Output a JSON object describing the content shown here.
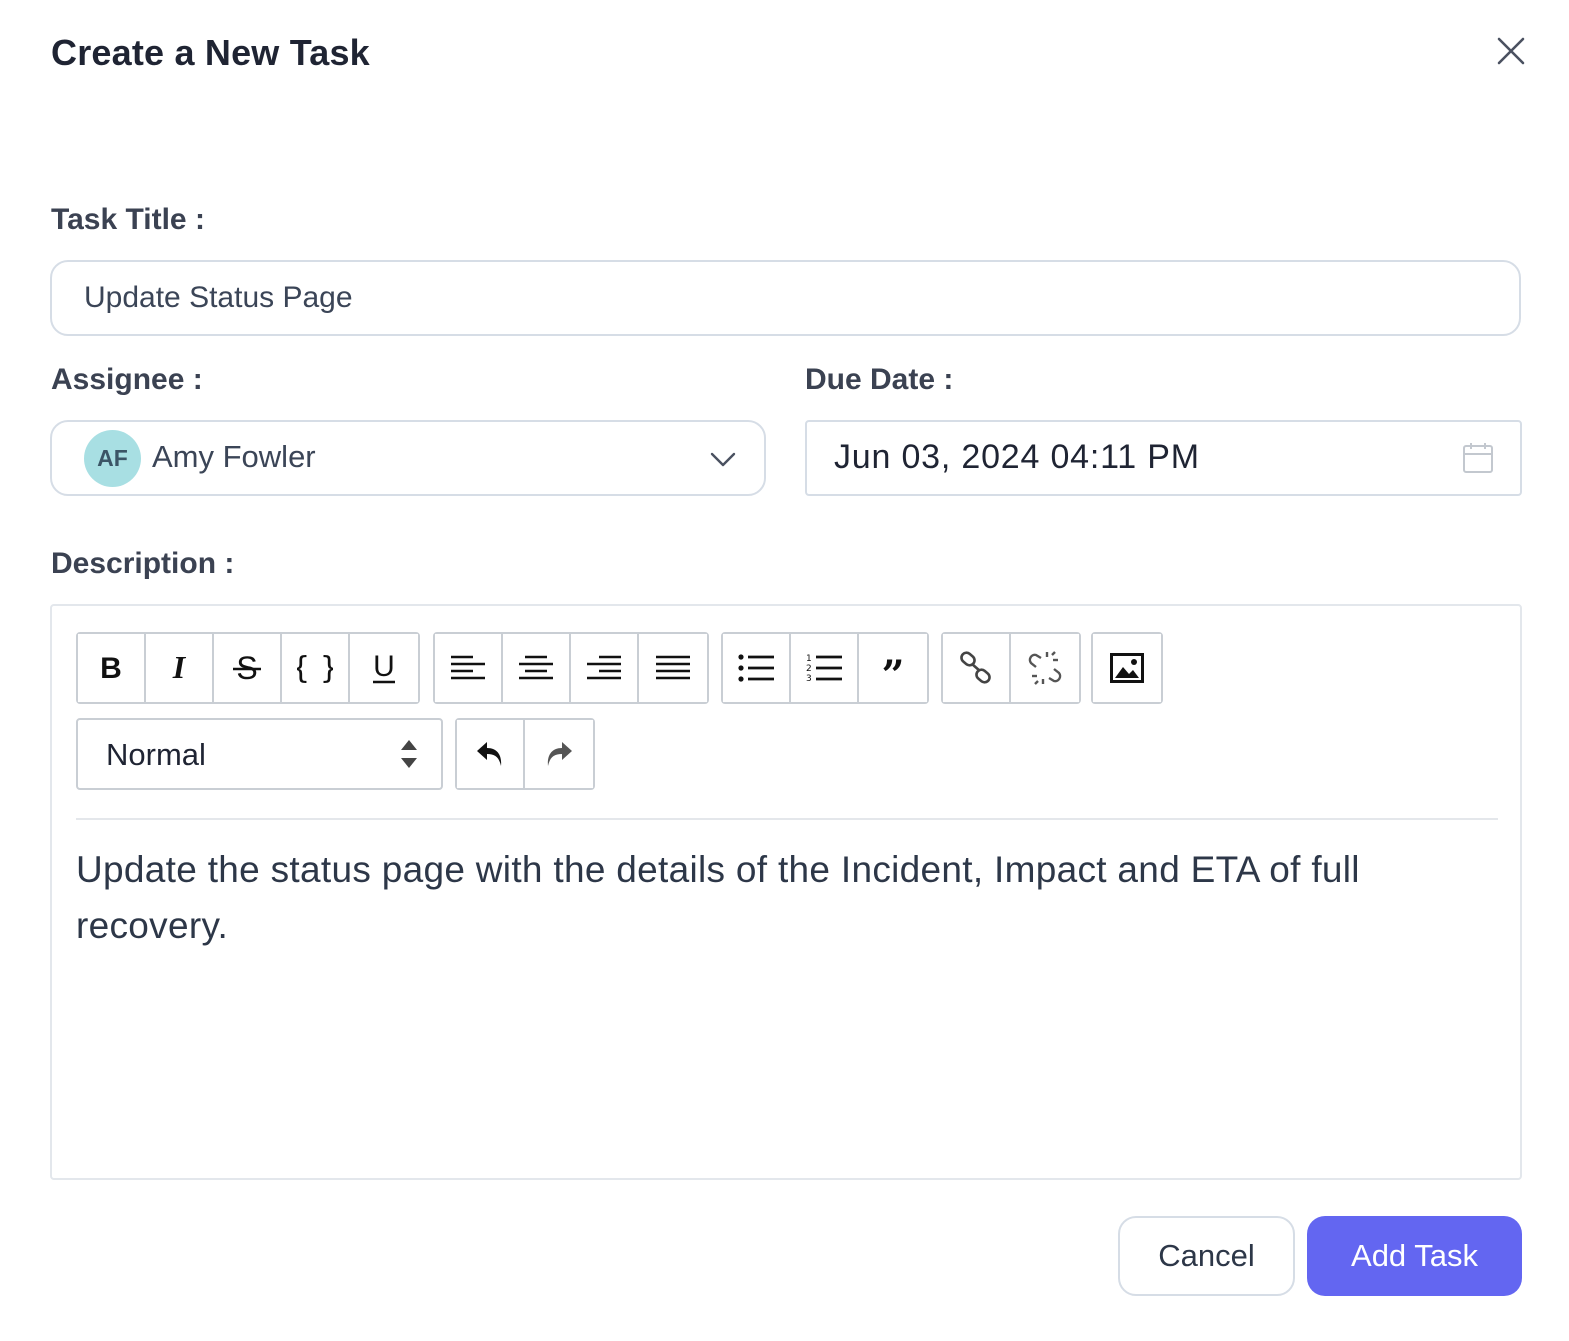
{
  "dialog": {
    "title": "Create a New Task",
    "close_icon": "close-icon"
  },
  "form": {
    "task_title_label": "Task Title :",
    "task_title_value": "Update Status Page",
    "assignee_label": "Assignee :",
    "assignee": {
      "initials": "AF",
      "name": "Amy Fowler",
      "avatar_color": "#a8dfe3"
    },
    "due_date_label": "Due Date :",
    "due_date_value": "Jun 03, 2024 04:11 PM",
    "description_label": "Description :"
  },
  "editor": {
    "toolbar_groups": [
      [
        "bold-icon",
        "italic-icon",
        "strikethrough-icon",
        "code-icon",
        "underline-icon"
      ],
      [
        "align-left-icon",
        "align-center-icon",
        "align-right-icon",
        "align-justify-icon"
      ],
      [
        "bullet-list-icon",
        "ordered-list-icon",
        "blockquote-icon"
      ],
      [
        "link-icon",
        "unlink-icon"
      ],
      [
        "image-icon"
      ],
      [
        "undo-icon",
        "redo-icon"
      ]
    ],
    "block_type": "Normal",
    "content": "Update the status page with the details of the Incident, Impact and ETA of full recovery."
  },
  "actions": {
    "cancel_label": "Cancel",
    "add_label": "Add Task",
    "primary_color": "#6366f1"
  }
}
